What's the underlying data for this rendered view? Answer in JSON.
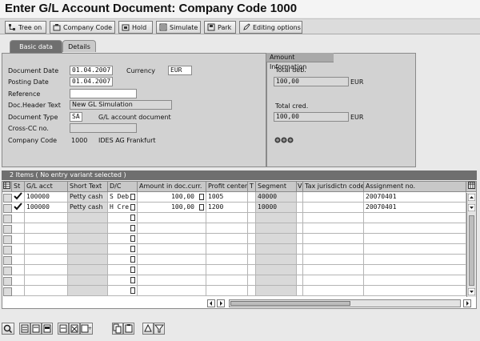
{
  "title": "Enter G/L Account Document: Company Code 1000",
  "toolbar": {
    "tree_on": "Tree on",
    "company_code": "Company Code",
    "hold": "Hold",
    "simulate": "Simulate",
    "park": "Park",
    "editing_options": "Editing options"
  },
  "tabs": {
    "basic_data": "Basic data",
    "details": "Details"
  },
  "form": {
    "document_date_label": "Document Date",
    "document_date": "01.04.2007",
    "currency_label": "Currency",
    "currency": "EUR",
    "posting_date_label": "Posting Date",
    "posting_date": "01.04.2007",
    "reference_label": "Reference",
    "reference": "",
    "header_text_label": "Doc.Header Text",
    "header_text": "New GL Simulation",
    "document_type_label": "Document Type",
    "document_type": "SA",
    "document_type_desc": "G/L account document",
    "cross_cc_label": "Cross-CC no.",
    "cross_cc": "",
    "company_code_label": "Company Code",
    "company_code": "1000",
    "company_code_desc": "IDES AG Frankfurt"
  },
  "amount_info": {
    "title": "Amount Information",
    "total_deb_label": "Total deb.",
    "total_deb": "100,00",
    "total_deb_currency": "EUR",
    "total_cred_label": "Total cred.",
    "total_cred": "100,00",
    "total_cred_currency": "EUR",
    "status_icon": "three-circle-traffic-light-icon"
  },
  "grid": {
    "title": "2 Items ( No entry variant selected )",
    "columns": [
      "St",
      "G/L acct",
      "Short Text",
      "D/C",
      "Amount in doc.curr.",
      "Profit center",
      "T",
      "Segment",
      "V",
      "Tax jurisdictn code",
      "Assignment no."
    ],
    "rows": [
      {
        "status": "check-icon",
        "gl_acct": "100000",
        "short_text": "Petty cash",
        "dc": "S Deb",
        "amount": "100,00",
        "profit_center": "1005",
        "t": "",
        "segment": "40000",
        "v": "",
        "tax": "",
        "assignment": "20070401"
      },
      {
        "status": "check-icon",
        "gl_acct": "100000",
        "short_text": "Petty cash",
        "dc": "H Cre",
        "amount": "100,00",
        "profit_center": "1200",
        "t": "",
        "segment": "10000",
        "v": "",
        "tax": "",
        "assignment": "20070401"
      }
    ]
  }
}
